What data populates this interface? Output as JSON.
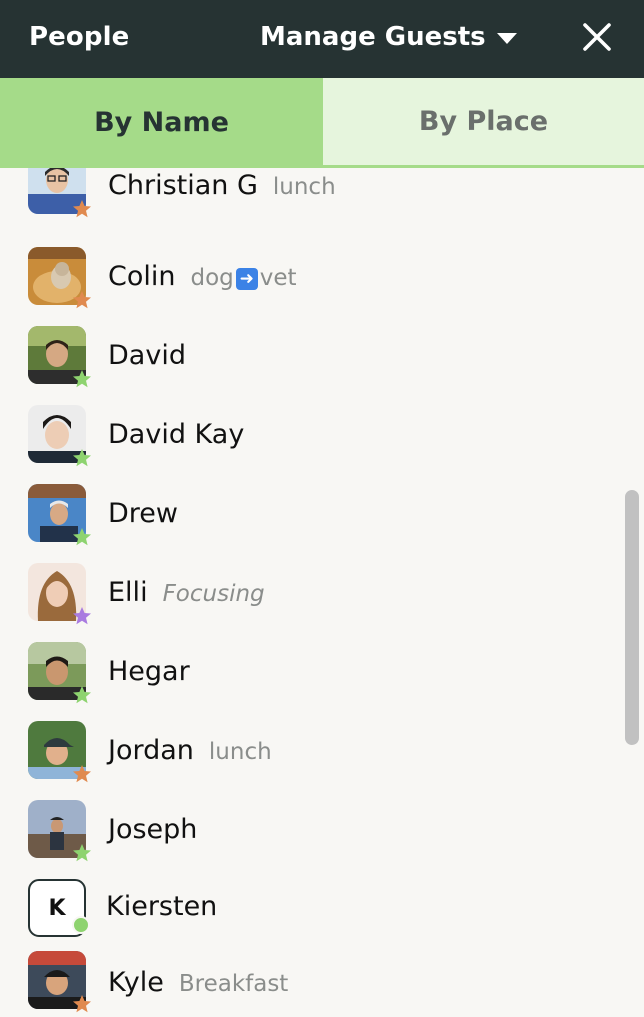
{
  "header": {
    "title": "People",
    "manage_label": "Manage Guests",
    "close_icon": "close-icon",
    "caret_icon": "caret-down-icon"
  },
  "tabs": [
    {
      "label": "By Name",
      "selected": true
    },
    {
      "label": "By Place",
      "selected": false
    }
  ],
  "colors": {
    "header_bg": "#263333",
    "tab_active": "#a5db89",
    "tab_inactive": "#e6f5dd",
    "star_orange": "#e08a4f",
    "star_green": "#8ed36f",
    "star_purple": "#a97be0"
  },
  "people": [
    {
      "name": "Christian G",
      "status": "lunch",
      "star": "orange"
    },
    {
      "name": "Colin",
      "status": "dog ➡️ vet",
      "star": "orange"
    },
    {
      "name": "David",
      "status": "",
      "star": "green"
    },
    {
      "name": "David Kay",
      "status": "",
      "star": "green"
    },
    {
      "name": "Drew",
      "status": "",
      "star": "green"
    },
    {
      "name": "Elli",
      "status": "Focusing",
      "star": "purple"
    },
    {
      "name": "Hegar",
      "status": "",
      "star": "green"
    },
    {
      "name": "Jordan",
      "status": "lunch",
      "star": "orange"
    },
    {
      "name": "Joseph",
      "status": "",
      "star": "green"
    },
    {
      "name": "Kiersten",
      "status": "",
      "initial": "K",
      "presence": "online-dot"
    },
    {
      "name": "Kyle",
      "status": "Breakfast",
      "star": "orange"
    }
  ]
}
